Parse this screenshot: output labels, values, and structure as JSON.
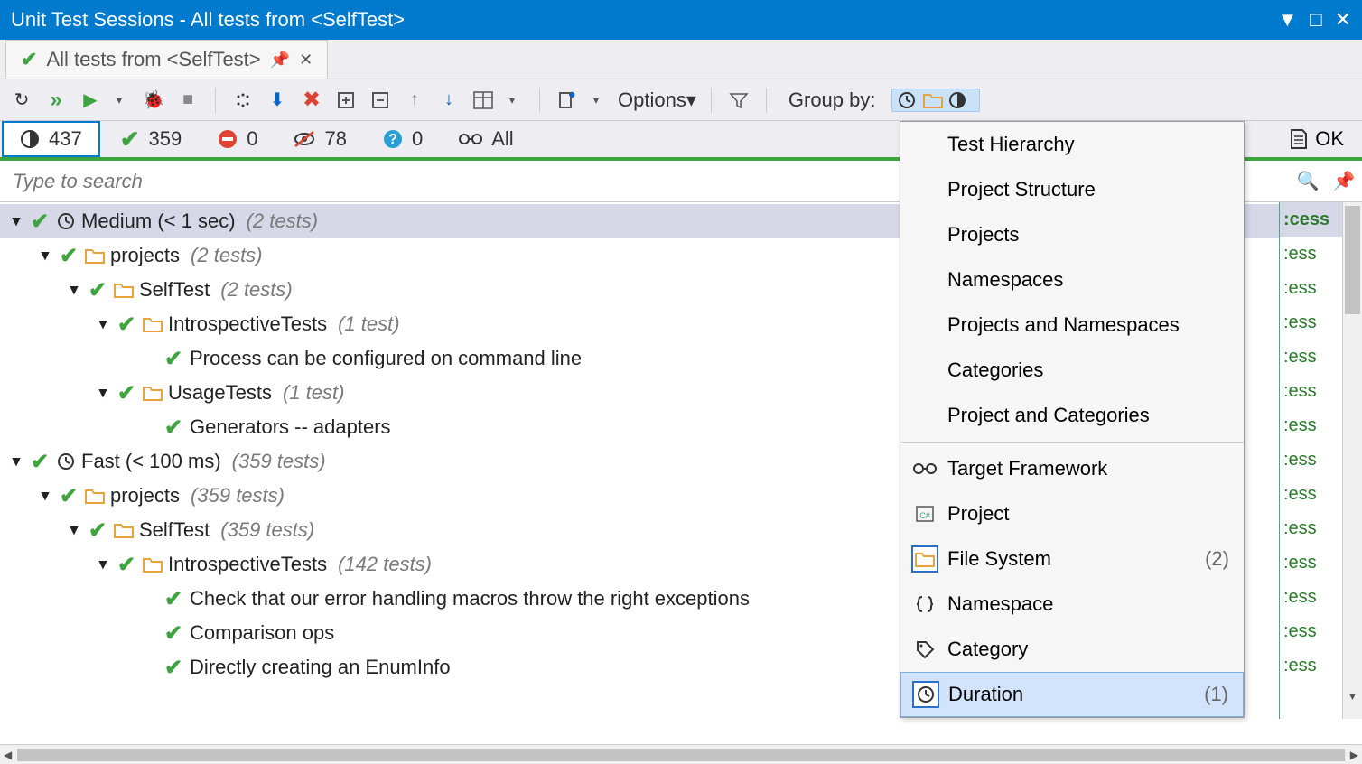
{
  "window": {
    "title": "Unit Test Sessions - All tests from <SelfTest>"
  },
  "tab": {
    "label": "All tests from <SelfTest>"
  },
  "toolbar": {
    "options": "Options",
    "groupby": "Group by:"
  },
  "status": {
    "total": "437",
    "passed": "359",
    "failed": "0",
    "skipped": "78",
    "unknown": "0",
    "all": "All",
    "ok_label": "OK"
  },
  "search": {
    "placeholder": "Type to search"
  },
  "tree": [
    {
      "d": 0,
      "arrow": true,
      "clock": true,
      "lbl": "Medium (< 1 sec)",
      "cnt": "(2 tests)",
      "sel": true,
      "r": ":cess"
    },
    {
      "d": 1,
      "arrow": true,
      "fold": true,
      "lbl": "projects",
      "cnt": "(2 tests)",
      "r": ":ess"
    },
    {
      "d": 2,
      "arrow": true,
      "fold": true,
      "lbl": "SelfTest",
      "cnt": "(2 tests)",
      "r": ":ess"
    },
    {
      "d": 3,
      "arrow": true,
      "fold": true,
      "lbl": "IntrospectiveTests",
      "cnt": "(1 test)",
      "r": ":ess"
    },
    {
      "d": 4,
      "arrow": false,
      "lbl": "Process can be configured on command line",
      "r": ":ess"
    },
    {
      "d": 3,
      "arrow": true,
      "fold": true,
      "lbl": "UsageTests",
      "cnt": "(1 test)",
      "r": ":ess"
    },
    {
      "d": 4,
      "arrow": false,
      "lbl": "Generators -- adapters",
      "r": ":ess"
    },
    {
      "d": 0,
      "arrow": true,
      "clock": true,
      "lbl": "Fast (< 100 ms)",
      "cnt": "(359 tests)",
      "r": ":ess"
    },
    {
      "d": 1,
      "arrow": true,
      "fold": true,
      "lbl": "projects",
      "cnt": "(359 tests)",
      "r": ":ess"
    },
    {
      "d": 2,
      "arrow": true,
      "fold": true,
      "lbl": "SelfTest",
      "cnt": "(359 tests)",
      "r": ":ess"
    },
    {
      "d": 3,
      "arrow": true,
      "fold": true,
      "lbl": "IntrospectiveTests",
      "cnt": "(142 tests)",
      "r": ":ess"
    },
    {
      "d": 4,
      "arrow": false,
      "lbl": "Check that our error handling macros throw the right exceptions",
      "r": ":ess"
    },
    {
      "d": 4,
      "arrow": false,
      "lbl": "Comparison ops",
      "r": ":ess"
    },
    {
      "d": 4,
      "arrow": false,
      "lbl": "Directly creating an EnumInfo",
      "r": ":ess"
    }
  ],
  "popup": {
    "top": [
      "Test Hierarchy",
      "Project Structure",
      "Projects",
      "Namespaces",
      "Projects and Namespaces",
      "Categories",
      "Project and Categories"
    ],
    "bottom": [
      {
        "icon": "link",
        "lbl": "Target Framework",
        "cnt": "",
        "boxed": false
      },
      {
        "icon": "csproj",
        "lbl": "Project",
        "cnt": "",
        "boxed": false
      },
      {
        "icon": "folder",
        "lbl": "File System",
        "cnt": "(2)",
        "boxed": true
      },
      {
        "icon": "braces",
        "lbl": "Namespace",
        "cnt": "",
        "boxed": false
      },
      {
        "icon": "tag",
        "lbl": "Category",
        "cnt": "",
        "boxed": false
      },
      {
        "icon": "clock",
        "lbl": "Duration",
        "cnt": "(1)",
        "boxed": true,
        "hl": true
      }
    ]
  }
}
